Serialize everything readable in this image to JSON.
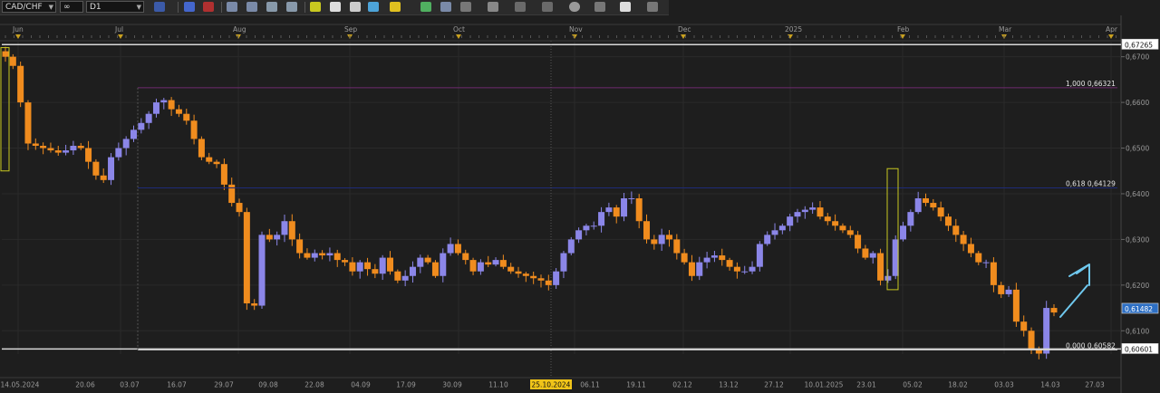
{
  "toolbar": {
    "symbol": "CAD/CHF",
    "link": "∞",
    "timeframe": "D1"
  },
  "chart_data": {
    "type": "candlestick",
    "ylim": [
      0.6049,
      0.6735
    ],
    "month_labels": [
      "Jun",
      "Jul",
      "Aug",
      "Sep",
      "Oct",
      "Nov",
      "Dec",
      "2025",
      "Feb",
      "Mar",
      "Apr"
    ],
    "date_labels": [
      "14.05.2024",
      "20.06",
      "03.07",
      "16.07",
      "29.07",
      "09.08",
      "22.08",
      "04.09",
      "17.09",
      "30.09",
      "11.10",
      "25.10.2024",
      "06.11",
      "19.11",
      "02.12",
      "13.12",
      "27.12",
      "10.01.2025",
      "23.01",
      "05.02",
      "18.02",
      "03.03",
      "14.03",
      "27.03"
    ],
    "highlighted_date": "25.10.2024",
    "price_ticks": [
      "0,6700",
      "0,6600",
      "0,6500",
      "0,6400",
      "0,6300",
      "0,6200",
      "0,6100"
    ],
    "price_tick_values": [
      0.67,
      0.66,
      0.65,
      0.64,
      0.63,
      0.62,
      0.61
    ],
    "current_price": "0,61482",
    "current_price_value": 0.61482,
    "top_line": "0,67265",
    "top_line_value": 0.67265,
    "bottom_line": "0,60601",
    "bottom_line_value": 0.60601,
    "fib_levels": [
      {
        "label": "1,000 0,66321",
        "value": 0.66321,
        "color": "#6f2a6f"
      },
      {
        "label": "0,618 0,64129",
        "value": 0.64129,
        "color": "#1e2a78"
      },
      {
        "label": "0,000 0,60582",
        "value": 0.60582,
        "color": "#d8d8d8"
      }
    ],
    "colors": {
      "bull": "#8b86e8",
      "bear": "#f08c1e",
      "grid": "#2a2a2a",
      "arrow": "#6fc8ee",
      "box": "#c8c820"
    },
    "anchors": [
      [
        0.67,
        0.668,
        0.66,
        0.651,
        0.6505,
        0.65,
        0.6495,
        0.649,
        0.6495,
        0.6505,
        0.65,
        0.647,
        0.644,
        0.643,
        0.648,
        0.65,
        0.652,
        0.654,
        0.6555,
        0.6575,
        0.66,
        0.6605,
        0.6585,
        0.6575,
        0.656,
        0.652,
        0.648,
        0.647,
        0.6465,
        0.642,
        0.638,
        0.636,
        0.616,
        0.6155,
        0.631,
        0.63,
        0.631,
        0.634,
        0.63,
        0.627,
        0.626,
        0.627,
        0.6265,
        0.627,
        0.6255,
        0.625,
        0.623,
        0.625,
        0.6235,
        0.6225,
        0.626,
        0.623,
        0.621,
        0.622,
        0.624,
        0.626,
        0.625,
        0.622,
        0.627,
        0.629,
        0.627,
        0.6255,
        0.623,
        0.625,
        0.6245,
        0.6255,
        0.624,
        0.623,
        0.6225,
        0.622,
        0.6215,
        0.621,
        0.62,
        0.623,
        0.627,
        0.63,
        0.632,
        0.633,
        0.633,
        0.636,
        0.637,
        0.635,
        0.639,
        0.639,
        0.634,
        0.63,
        0.629,
        0.631,
        0.63,
        0.627,
        0.625,
        0.622,
        0.625,
        0.626,
        0.6265,
        0.6255,
        0.624,
        0.623,
        0.623,
        0.624,
        0.629,
        0.631,
        0.632,
        0.633,
        0.635,
        0.636,
        0.6365,
        0.637,
        0.635,
        0.634,
        0.633,
        0.632,
        0.631,
        0.628,
        0.626,
        0.627,
        0.621,
        0.622,
        0.63,
        0.633,
        0.636,
        0.639,
        0.638,
        0.637,
        0.635,
        0.633,
        0.631,
        0.629,
        0.627,
        0.625,
        0.625,
        0.62,
        0.618,
        0.619,
        0.612,
        0.61,
        0.606,
        0.605,
        0.615,
        0.614
      ]
    ]
  },
  "annotations": {
    "up_arrow": "arrow-up-right"
  }
}
